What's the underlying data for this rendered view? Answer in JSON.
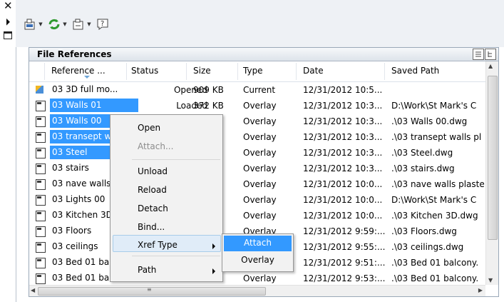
{
  "panel": {
    "title": "File References"
  },
  "columns": [
    "Reference ...",
    "Status",
    "Size",
    "Type",
    "Date",
    "Saved Path"
  ],
  "rows": [
    {
      "name": "03 3D full mo...",
      "status": "Opened",
      "size": "909 KB",
      "type": "Current",
      "date": "12/31/2012 10:5...",
      "path": "",
      "selected": false,
      "current": true
    },
    {
      "name": "03 Walls 01",
      "status": "Loaded",
      "size": "372 KB",
      "type": "Overlay",
      "date": "12/31/2012 10:3...",
      "path": "D:\\Work\\St Mark's C",
      "selected": true
    },
    {
      "name": "03 Walls 00",
      "status": "",
      "size": "",
      "type": "Overlay",
      "date": "12/31/2012 10:3...",
      "path": ".\\03 Walls 00.dwg",
      "selected": true
    },
    {
      "name": "03 transept w",
      "status": "",
      "size": "",
      "type": "Overlay",
      "date": "12/31/2012 10:3...",
      "path": ".\\03 transept walls pl",
      "selected": true
    },
    {
      "name": "03 Steel",
      "status": "",
      "size": "",
      "type": "Overlay",
      "date": "12/31/2012 10:3...",
      "path": ".\\03 Steel.dwg",
      "selected": true
    },
    {
      "name": "03 stairs",
      "status": "",
      "size": "",
      "type": "Overlay",
      "date": "12/31/2012 10:3...",
      "path": ".\\03 stairs.dwg",
      "selected": false
    },
    {
      "name": "03 nave walls",
      "status": "",
      "size": "",
      "type": "Overlay",
      "date": "12/31/2012 10:0...",
      "path": ".\\03 nave walls plaste",
      "selected": false
    },
    {
      "name": "03 Lights 00",
      "status": "",
      "size": "",
      "type": "Overlay",
      "date": "12/31/2012 10:0...",
      "path": "D:\\Work\\St Mark's C",
      "selected": false
    },
    {
      "name": "03 Kitchen 3D",
      "status": "",
      "size": "",
      "type": "Overlay",
      "date": "12/31/2012 10:0...",
      "path": ".\\03 Kitchen 3D.dwg",
      "selected": false
    },
    {
      "name": "03 Floors",
      "status": "",
      "size": "",
      "type": "Overlay",
      "date": "12/31/2012 9:59:...",
      "path": ".\\03 Floors.dwg",
      "selected": false
    },
    {
      "name": "03 ceilings",
      "status": "",
      "size": "",
      "type": "",
      "date": "12/31/2012 9:55:...",
      "path": ".\\03 ceilings.dwg",
      "selected": false
    },
    {
      "name": "03 Bed 01 bal",
      "status": "",
      "size": "",
      "type": "",
      "date": "12/31/2012 9:51:...",
      "path": ".\\03 Bed 01 balcony.",
      "selected": false
    },
    {
      "name": "03 Bed 01 bal...",
      "status": "",
      "size": "",
      "type": "Overlay",
      "date": "12/31/2012 9:53:...",
      "path": ".\\03 Bed 01 balcony.",
      "selected": false
    }
  ],
  "context_menu": {
    "items": [
      "Open",
      "Attach...",
      "Unload",
      "Reload",
      "Detach",
      "Bind...",
      "Xref Type",
      "Path"
    ],
    "disabled": [
      "Attach..."
    ]
  },
  "submenu": {
    "items": [
      "Attach",
      "Overlay"
    ],
    "highlighted": "Attach"
  },
  "colors": {
    "selection": "#3399ff",
    "panel_border": "#9aa8b8",
    "menu_bg": "#f2f2f2"
  },
  "icons": {
    "close": "close-icon",
    "pin": "auto-hide-icon",
    "properties": "properties-icon",
    "attach_dwg": "attach-dwg-icon",
    "refresh": "refresh-icon",
    "change_path": "change-path-icon",
    "help": "help-icon",
    "list_view": "list-view-icon",
    "tree_view": "tree-view-icon"
  }
}
